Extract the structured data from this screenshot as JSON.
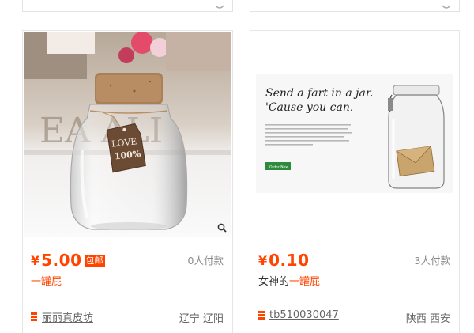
{
  "products": [
    {
      "price_symbol": "¥",
      "price": "5.00",
      "badge": "包邮",
      "paid_count": "0人付款",
      "title_prefix": "",
      "title_highlight": "一罐屁",
      "shop": "丽丽真皮坊",
      "location": "辽宁 辽阳",
      "image": {
        "jar_label_line1": "LOVE",
        "jar_label_line2": "100%",
        "backdrop_text": "EA  ALI"
      }
    },
    {
      "price_symbol": "¥",
      "price": "0.10",
      "badge": "",
      "paid_count": "3人付款",
      "title_prefix": "女神的",
      "title_highlight": "一罐屁",
      "shop": "tb510030047",
      "location": "陕西 西安",
      "image": {
        "headline1": "Send a fart in a jar.",
        "headline2": "'Cause you can.",
        "button": "Order Now"
      }
    }
  ],
  "colors": {
    "accent": "#ff4400",
    "muted": "#888888",
    "text": "#333333",
    "border": "#e6e6e6"
  },
  "icons": {
    "zoom": "magnifier-icon",
    "shop": "shop-list-icon"
  }
}
